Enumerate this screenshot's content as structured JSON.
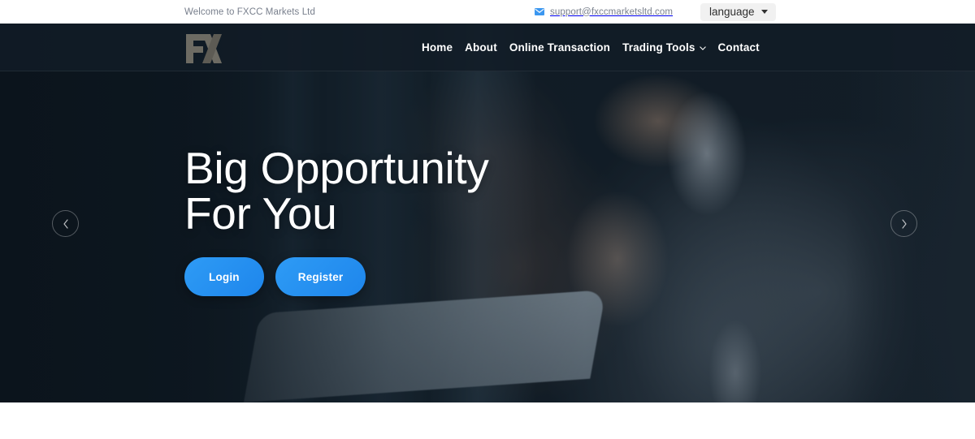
{
  "topbar": {
    "welcome_text": "Welcome to FXCC Markets Ltd",
    "mail_icon": "envelope-icon",
    "email": "support@fxccmarketsltd.com",
    "language_label": "language",
    "language_caret_icon": "caret-down-icon",
    "background_color": "#ffffff",
    "text_color": "#787f8c",
    "mail_icon_color": "#3b97f0",
    "language_bg_color": "#f1f1f1"
  },
  "navbar": {
    "logo_alt": "FX",
    "logo_color": "#6d6b63",
    "background_color": "#121c26",
    "links": [
      {
        "label": "Home",
        "has_dropdown": false
      },
      {
        "label": "About",
        "has_dropdown": false
      },
      {
        "label": "Online Transaction",
        "has_dropdown": false
      },
      {
        "label": "Trading Tools",
        "has_dropdown": true,
        "dropdown_icon": "chevron-down-icon"
      },
      {
        "label": "Contact",
        "has_dropdown": false
      }
    ]
  },
  "hero": {
    "title_line1": "Big Opportunity",
    "title_line2": "For You",
    "title": "Big Opportunity\nFor You",
    "title_color": "#ffffff",
    "login_label": "Login",
    "register_label": "Register",
    "button_color": "#2e9bf5",
    "prev_icon": "chevron-left-icon",
    "next_icon": "chevron-right-icon",
    "background_description": "businessman-in-suit-photo",
    "background_color": "#101a23"
  }
}
